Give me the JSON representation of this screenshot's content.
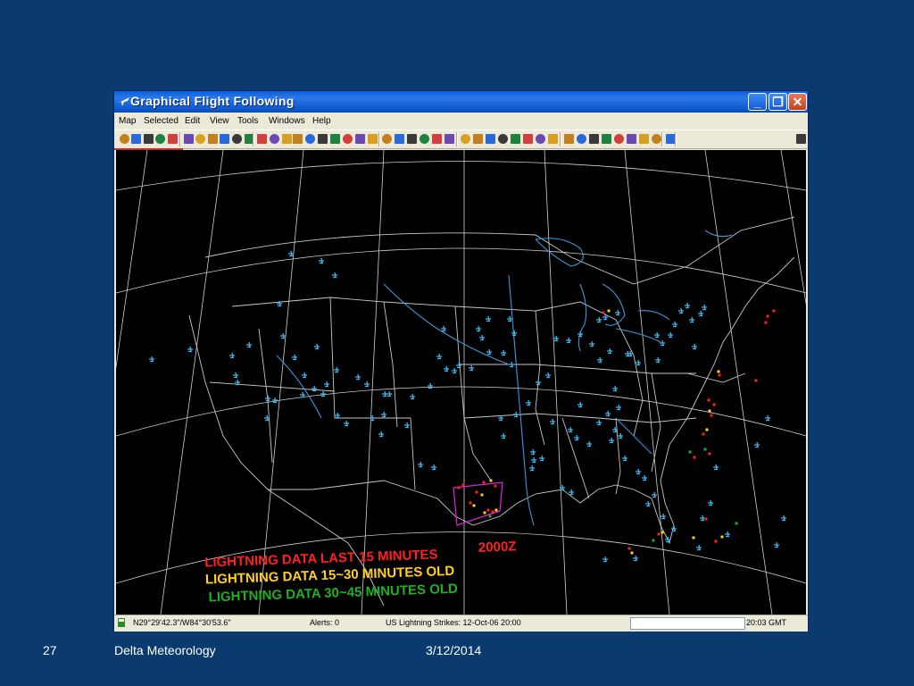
{
  "window": {
    "title": "Graphical Flight Following",
    "buttons": {
      "minimize": "_",
      "maximize": "❐",
      "close": "✕"
    }
  },
  "menu": [
    "Map",
    "Selected",
    "Edit",
    "View",
    "Tools",
    "Windows",
    "Help"
  ],
  "map": {
    "legend": {
      "line1": "LIGHTNING DATA  LAST 15 MINUTES",
      "time": "2000Z",
      "line2": "LIGHTNING DATA 15~30 MINUTES OLD",
      "line3": "LIGHTNING DATA 30~45 MINUTES OLD"
    },
    "colors": {
      "background": "#000000",
      "lines": "#d8d8d8",
      "water": "#3a9ad8",
      "aircraft": "#3ab8f0",
      "recent": "#ff2020",
      "mid": "#ffd020",
      "old": "#20b020",
      "box": "#e020e0"
    },
    "aircraft_icon": "airplane-icon"
  },
  "status": {
    "coords": "N29°29'42.3\"/W84°30'53.6\"",
    "alerts": "Alerts: 0",
    "strikes": "US Lightning Strikes: 12-Oct-06 20:00",
    "time": "20:03 GMT"
  },
  "footer": {
    "slide_number": "27",
    "org": "Delta Meteorology",
    "date": "3/12/2014"
  }
}
